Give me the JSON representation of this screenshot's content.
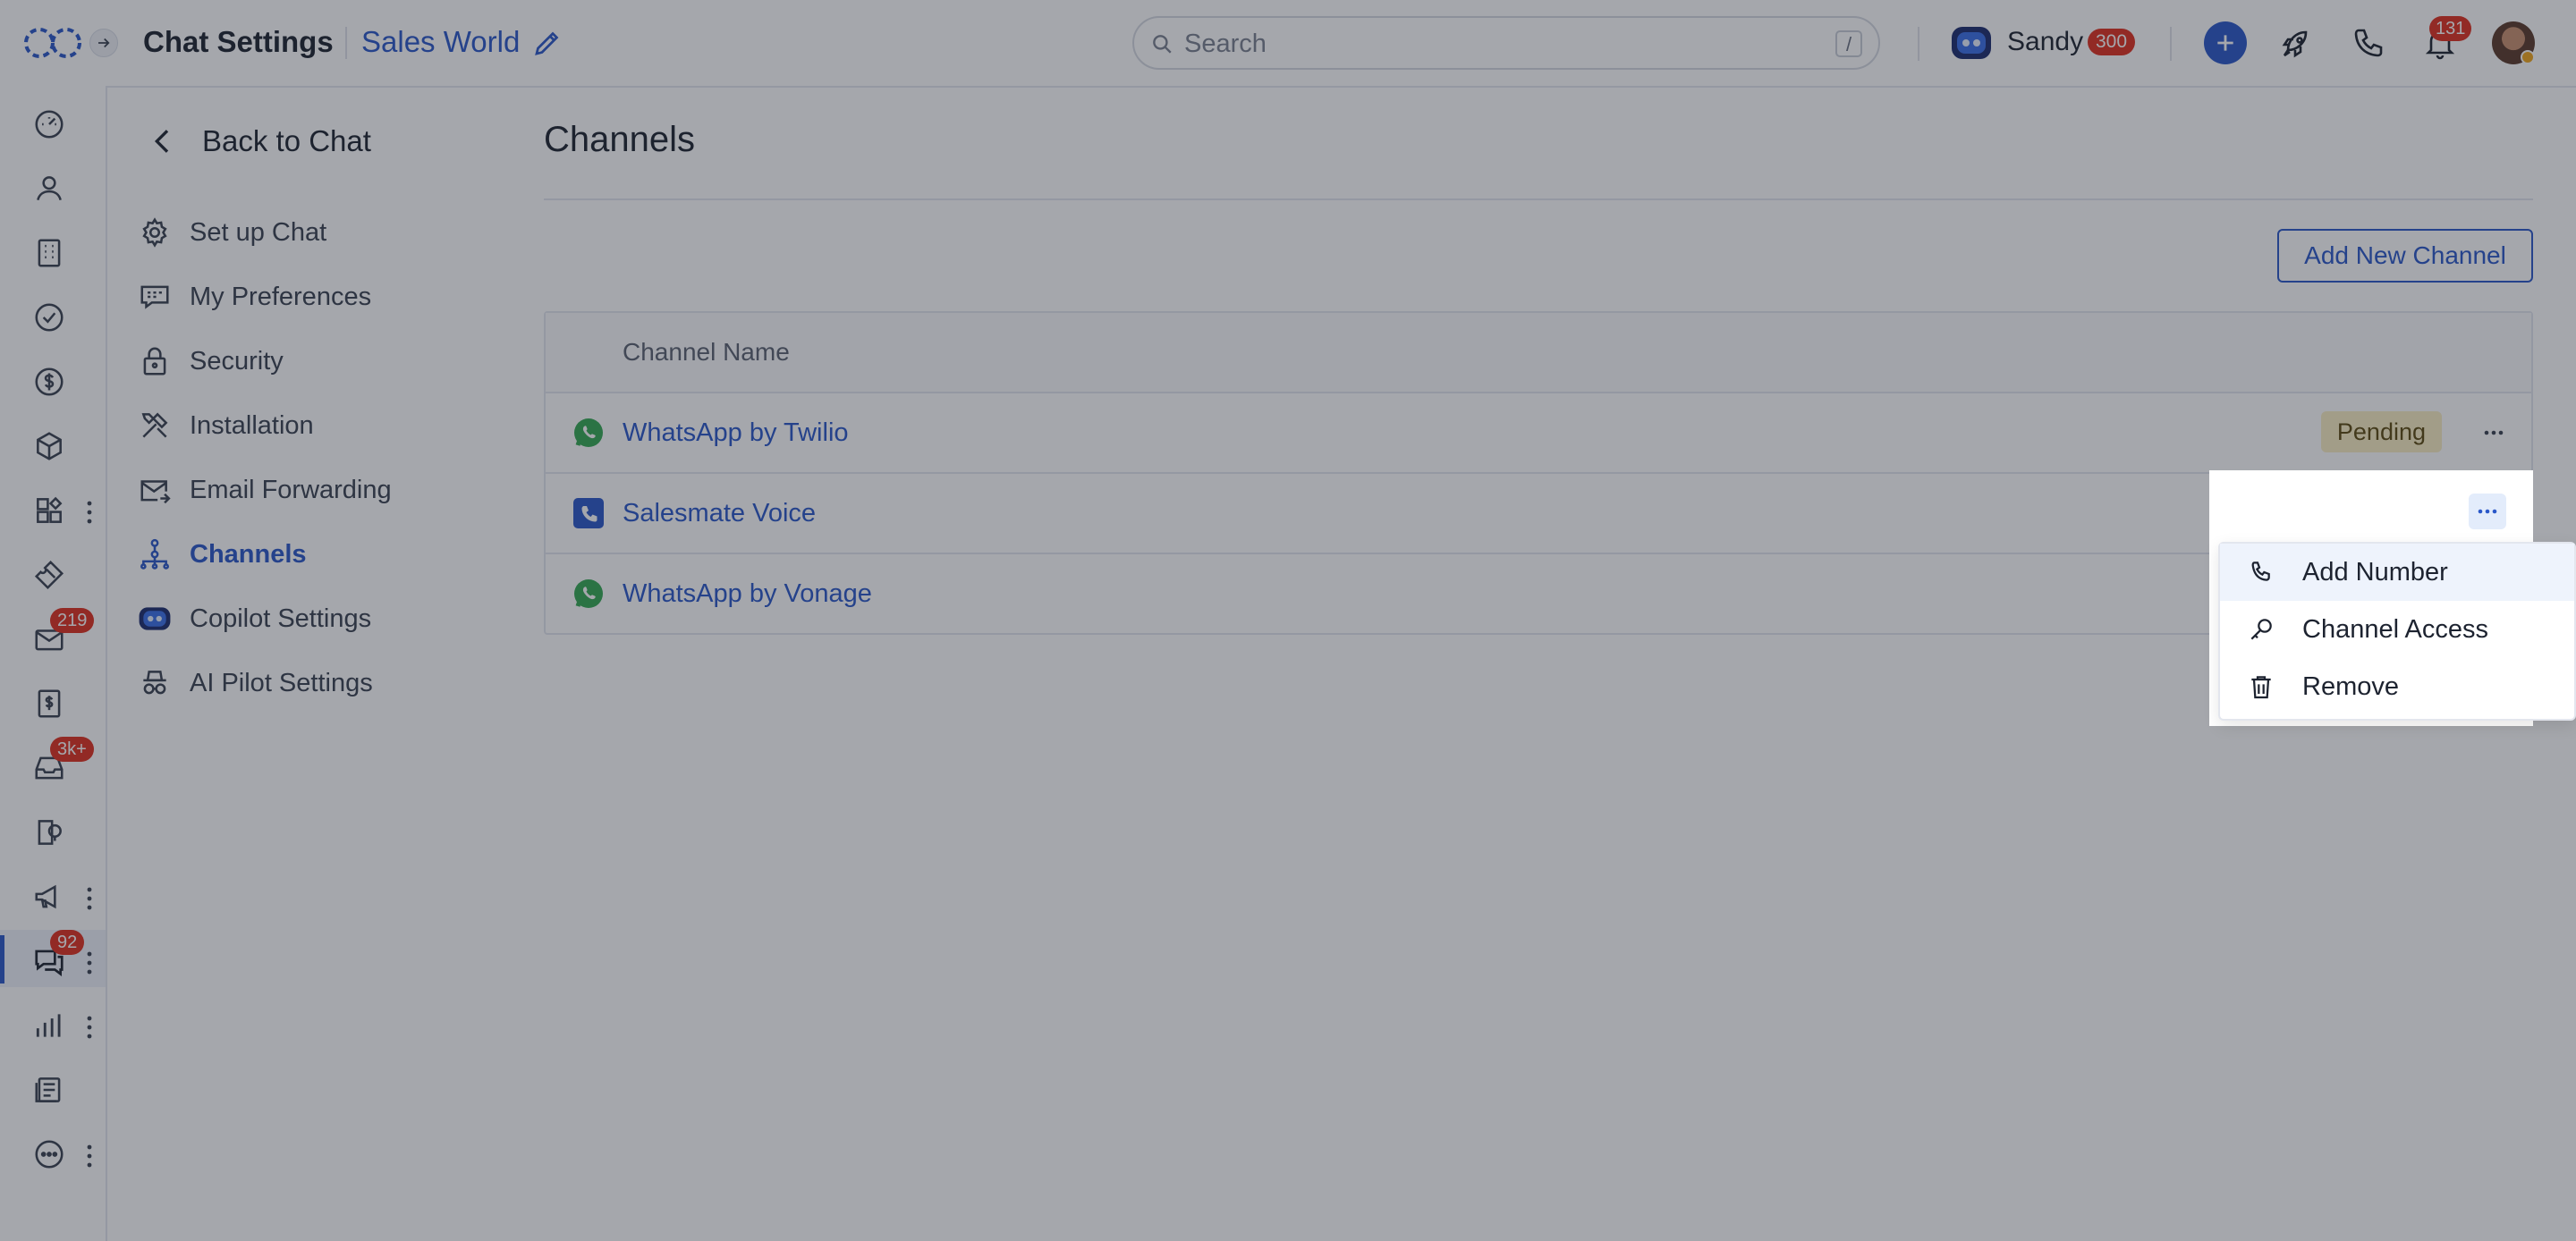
{
  "header": {
    "title": "Chat Settings",
    "workspace": "Sales World",
    "search_placeholder": "Search",
    "search_shortcut": "/",
    "user_name": "Sandy",
    "credits": "300",
    "notifications": "131"
  },
  "rail": {
    "badges": {
      "email": "219",
      "inbox": "3k+",
      "chat": "92"
    }
  },
  "settings_nav": {
    "back_label": "Back to Chat",
    "items": [
      {
        "label": "Set up Chat",
        "icon": "gear-icon"
      },
      {
        "label": "My Preferences",
        "icon": "chat-preferences-icon"
      },
      {
        "label": "Security",
        "icon": "lock-icon"
      },
      {
        "label": "Installation",
        "icon": "tools-icon"
      },
      {
        "label": "Email Forwarding",
        "icon": "envelope-forward-icon"
      },
      {
        "label": "Channels",
        "icon": "channels-icon",
        "active": true
      },
      {
        "label": "Copilot Settings",
        "icon": "copilot-icon"
      },
      {
        "label": "AI Pilot Settings",
        "icon": "ai-pilot-icon"
      }
    ]
  },
  "main": {
    "title": "Channels",
    "add_button": "Add New Channel",
    "table": {
      "header": "Channel Name",
      "rows": [
        {
          "name": "WhatsApp by Twilio",
          "icon": "whatsapp-icon",
          "status": "Pending"
        },
        {
          "name": "Salesmate Voice",
          "icon": "salesmate-voice-icon",
          "status": ""
        },
        {
          "name": "WhatsApp by Vonage",
          "icon": "whatsapp-icon",
          "status": ""
        }
      ]
    },
    "row_menu": {
      "items": [
        {
          "label": "Add Number",
          "icon": "phone-icon"
        },
        {
          "label": "Channel Access",
          "icon": "key-icon"
        },
        {
          "label": "Remove",
          "icon": "trash-icon"
        }
      ]
    }
  },
  "colors": {
    "accent": "#2a58c9",
    "badge_red": "#e0301e",
    "pending_bg": "#fbefc4",
    "whatsapp_green": "#34a853"
  }
}
